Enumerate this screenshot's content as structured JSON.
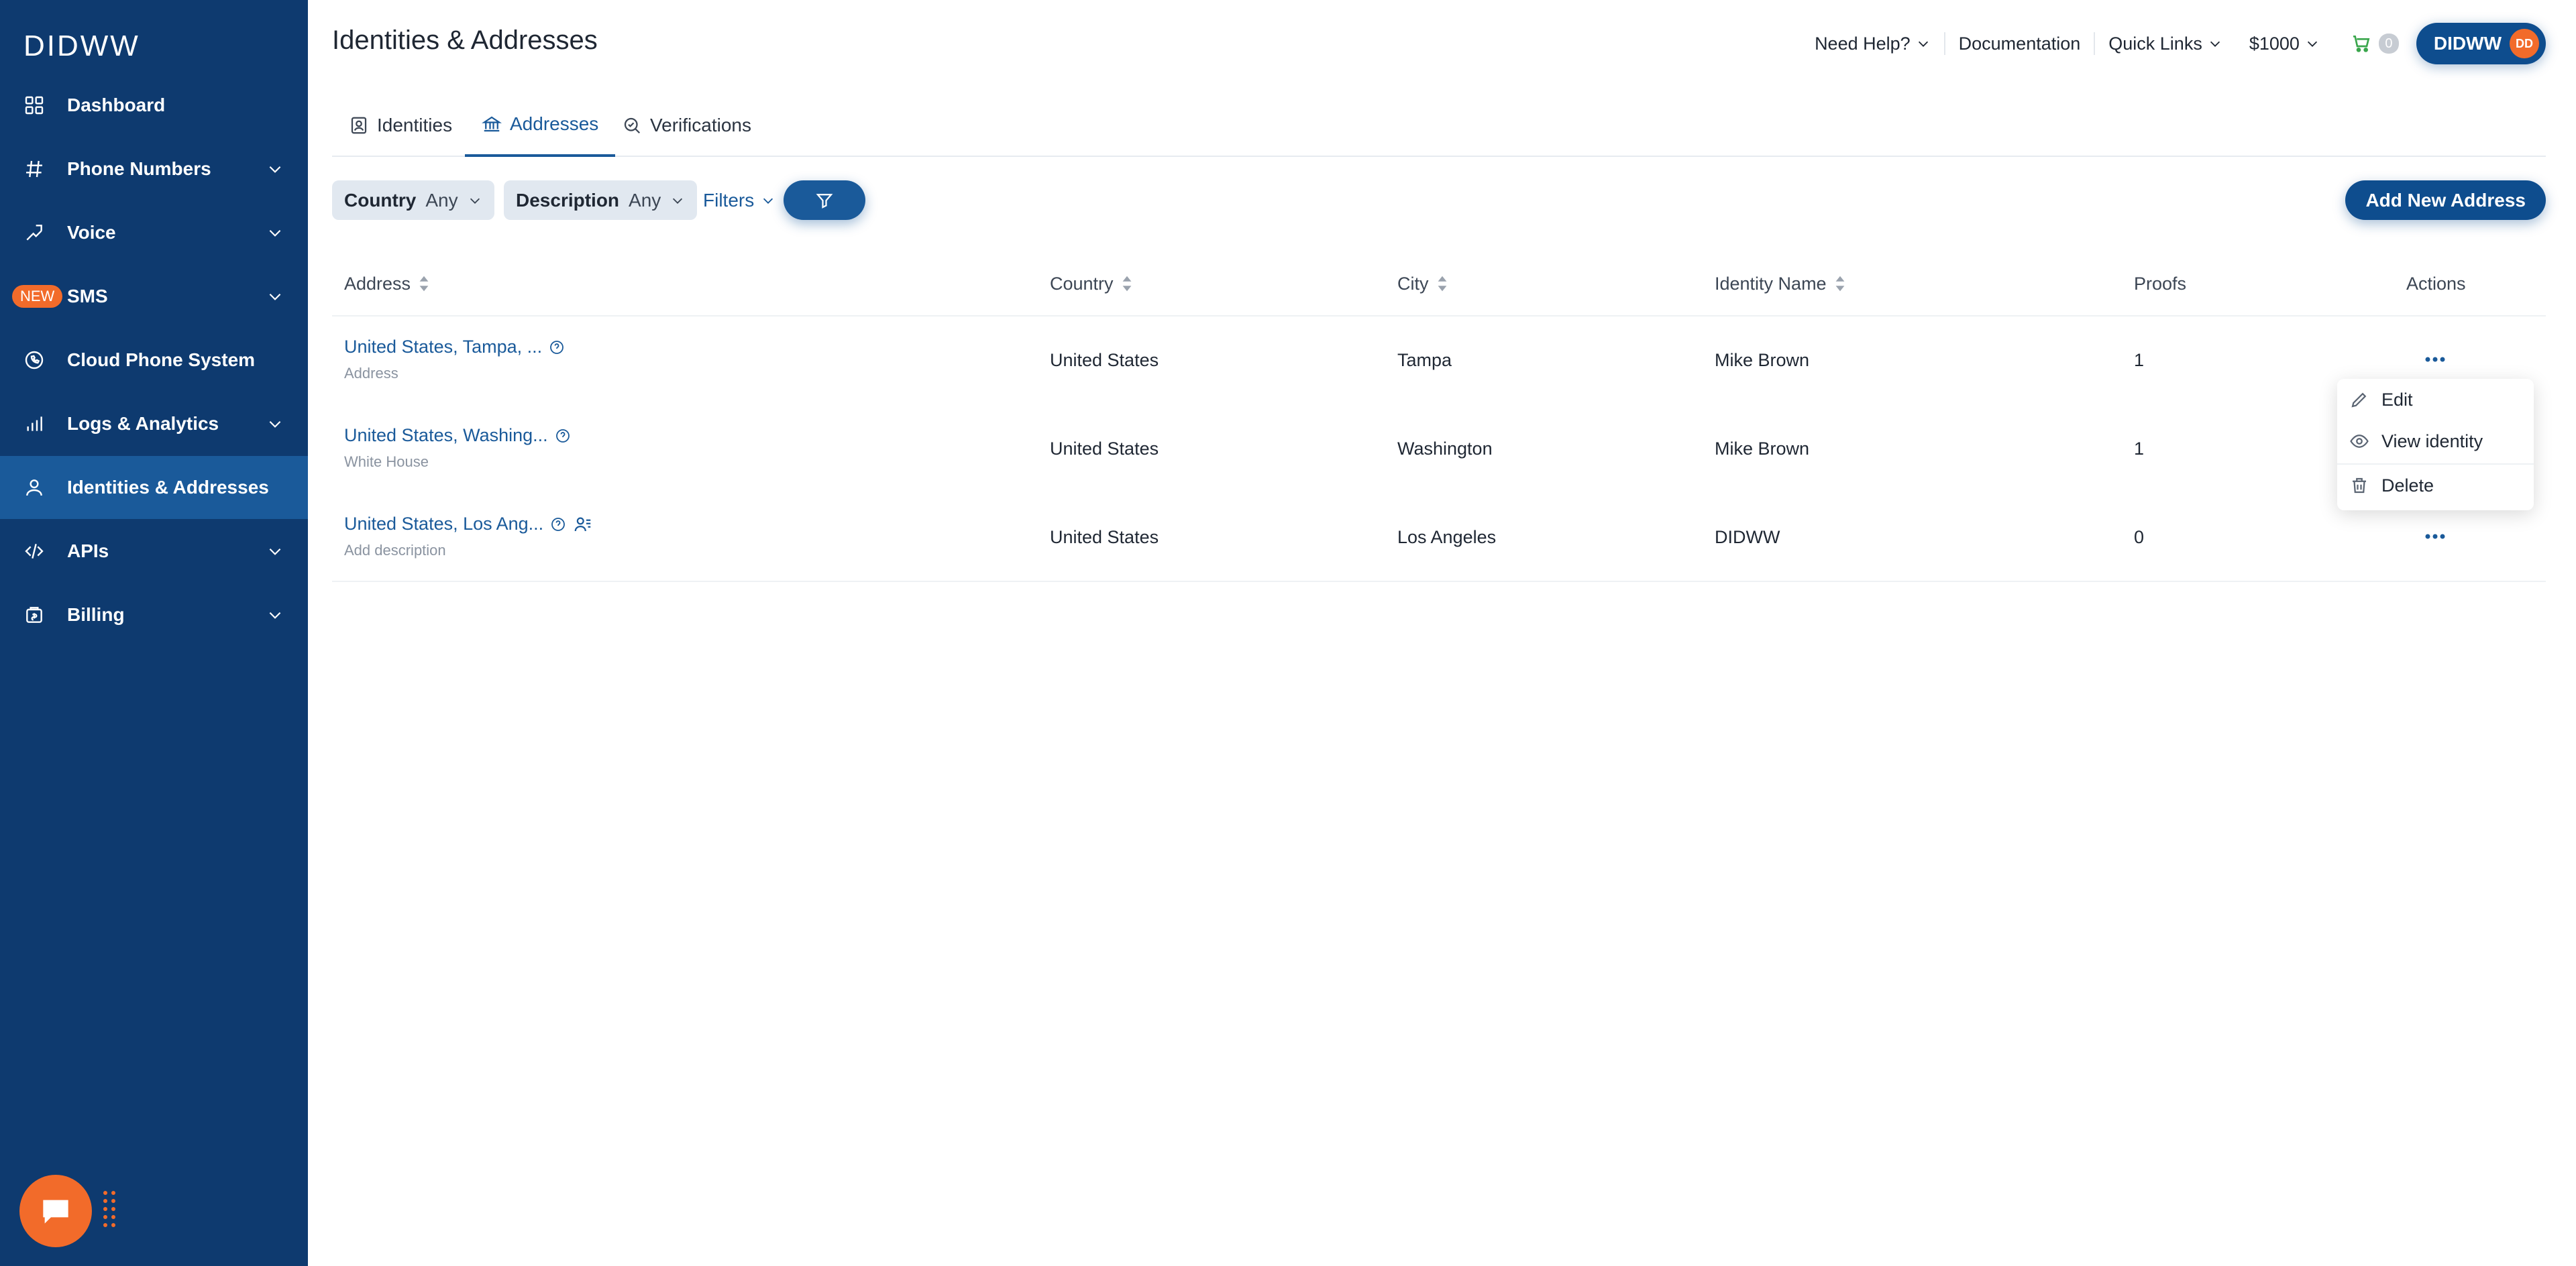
{
  "sidebar": {
    "logo": "DIDWW",
    "items": [
      {
        "label": "Dashboard",
        "icon": "grid-icon",
        "chevron": false
      },
      {
        "label": "Phone Numbers",
        "icon": "hash-icon",
        "chevron": true
      },
      {
        "label": "Voice",
        "icon": "call-arrow-icon",
        "chevron": true
      },
      {
        "label": "SMS",
        "icon": "sms-icon",
        "chevron": true,
        "badge": "NEW"
      },
      {
        "label": "Cloud Phone System",
        "icon": "cloud-phone-icon",
        "chevron": false
      },
      {
        "label": "Logs & Analytics",
        "icon": "bar-chart-icon",
        "chevron": true
      },
      {
        "label": "Identities & Addresses",
        "icon": "user-icon",
        "chevron": false,
        "active": true
      },
      {
        "label": "APIs",
        "icon": "code-icon",
        "chevron": true
      },
      {
        "label": "Billing",
        "icon": "billing-icon",
        "chevron": true
      }
    ]
  },
  "header": {
    "title": "Identities & Addresses",
    "need_help": "Need Help?",
    "documentation": "Documentation",
    "quick_links": "Quick Links",
    "balance": "$1000",
    "cart_count": "0",
    "account": "DIDWW",
    "avatar_initials": "DD"
  },
  "tabs": [
    {
      "label": "Identities",
      "icon": "id-card-icon"
    },
    {
      "label": "Addresses",
      "icon": "bank-icon",
      "active": true
    },
    {
      "label": "Verifications",
      "icon": "search-check-icon"
    }
  ],
  "filters": {
    "country_label": "Country",
    "country_value": "Any",
    "description_label": "Description",
    "description_value": "Any",
    "filters_label": "Filters",
    "add_button": "Add New Address"
  },
  "table": {
    "columns": [
      "Address",
      "Country",
      "City",
      "Identity Name",
      "Proofs",
      "Actions"
    ],
    "rows": [
      {
        "address": "United States, Tampa, ...",
        "sub": "Address",
        "country": "United States",
        "city": "Tampa",
        "identity": "Mike Brown",
        "proofs": "1"
      },
      {
        "address": "United States, Washing...",
        "sub": "White House",
        "country": "United States",
        "city": "Washington",
        "identity": "Mike Brown",
        "proofs": "1"
      },
      {
        "address": "United States, Los Ang...",
        "sub": "Add description",
        "country": "United States",
        "city": "Los Angeles",
        "identity": "DIDWW",
        "proofs": "0"
      }
    ]
  },
  "actions_menu": {
    "edit": "Edit",
    "view_identity": "View identity",
    "delete": "Delete"
  },
  "colors": {
    "sidebar": "#0e3a6f",
    "sidebar_active": "#1a5a9a",
    "accent": "#1a5a9a",
    "orange": "#f26b2a",
    "cart_green": "#3aa64c"
  }
}
